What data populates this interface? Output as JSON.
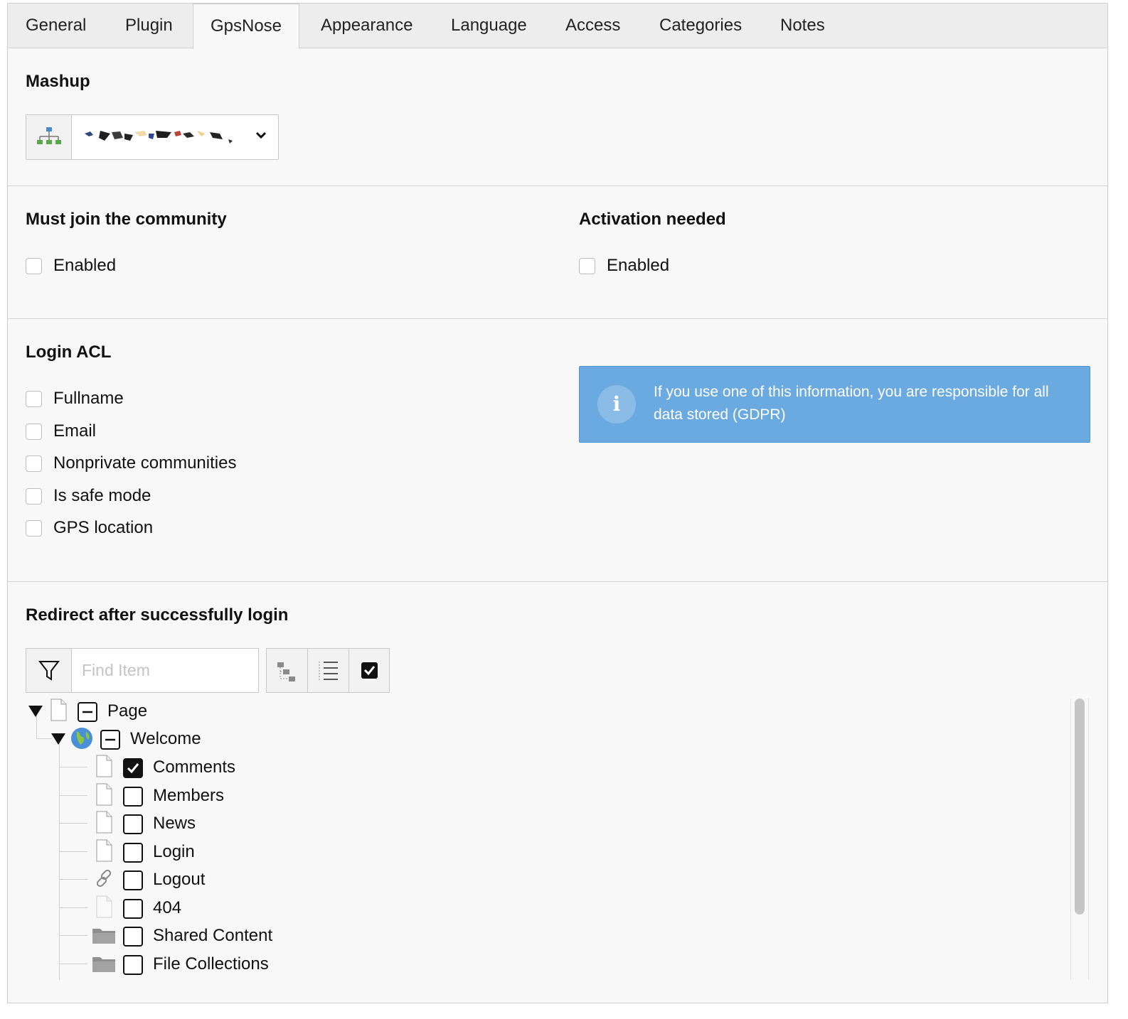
{
  "tabs": [
    {
      "label": "General",
      "active": false
    },
    {
      "label": "Plugin",
      "active": false
    },
    {
      "label": "GpsNose",
      "active": true
    },
    {
      "label": "Appearance",
      "active": false
    },
    {
      "label": "Language",
      "active": false
    },
    {
      "label": "Access",
      "active": false
    },
    {
      "label": "Categories",
      "active": false
    },
    {
      "label": "Notes",
      "active": false
    }
  ],
  "mashup": {
    "heading": "Mashup",
    "addon_icon": "sitemap-icon",
    "value_icon": "redacted-value",
    "dropdown_icon": "chevron-down-icon"
  },
  "community": {
    "heading": "Must join the community",
    "checkbox_label": "Enabled",
    "checked": false
  },
  "activation": {
    "heading": "Activation needed",
    "checkbox_label": "Enabled",
    "checked": false
  },
  "login_acl": {
    "heading": "Login ACL",
    "options": [
      {
        "label": "Fullname",
        "checked": false
      },
      {
        "label": "Email",
        "checked": false
      },
      {
        "label": "Nonprivate communities",
        "checked": false
      },
      {
        "label": "Is safe mode",
        "checked": false
      },
      {
        "label": "GPS location",
        "checked": false
      }
    ],
    "info_text": "If you use one of this information, you are responsible for all data stored (GDPR)",
    "info_color": "#6aaae0"
  },
  "redirect": {
    "heading": "Redirect after successfully login",
    "search_placeholder": "Find Item",
    "filter_icon": "filter-icon",
    "toolbar_icons": [
      "collapse-tree-icon",
      "expand-list-icon",
      "check-all-icon"
    ],
    "tree": {
      "root": {
        "label": "Page",
        "icon": "page-icon",
        "expanded": true
      },
      "site": {
        "label": "Welcome",
        "icon": "globe-icon",
        "expanded": true
      },
      "children": [
        {
          "label": "Comments",
          "icon": "page-icon",
          "checked": true
        },
        {
          "label": "Members",
          "icon": "page-icon",
          "checked": false
        },
        {
          "label": "News",
          "icon": "page-icon",
          "checked": false
        },
        {
          "label": "Login",
          "icon": "page-icon",
          "checked": false
        },
        {
          "label": "Logout",
          "icon": "link-icon",
          "checked": false
        },
        {
          "label": "404",
          "icon": "page-faded-icon",
          "checked": false
        },
        {
          "label": "Shared Content",
          "icon": "folder-icon",
          "checked": false
        },
        {
          "label": "File Collections",
          "icon": "folder-icon",
          "checked": false
        }
      ]
    }
  }
}
